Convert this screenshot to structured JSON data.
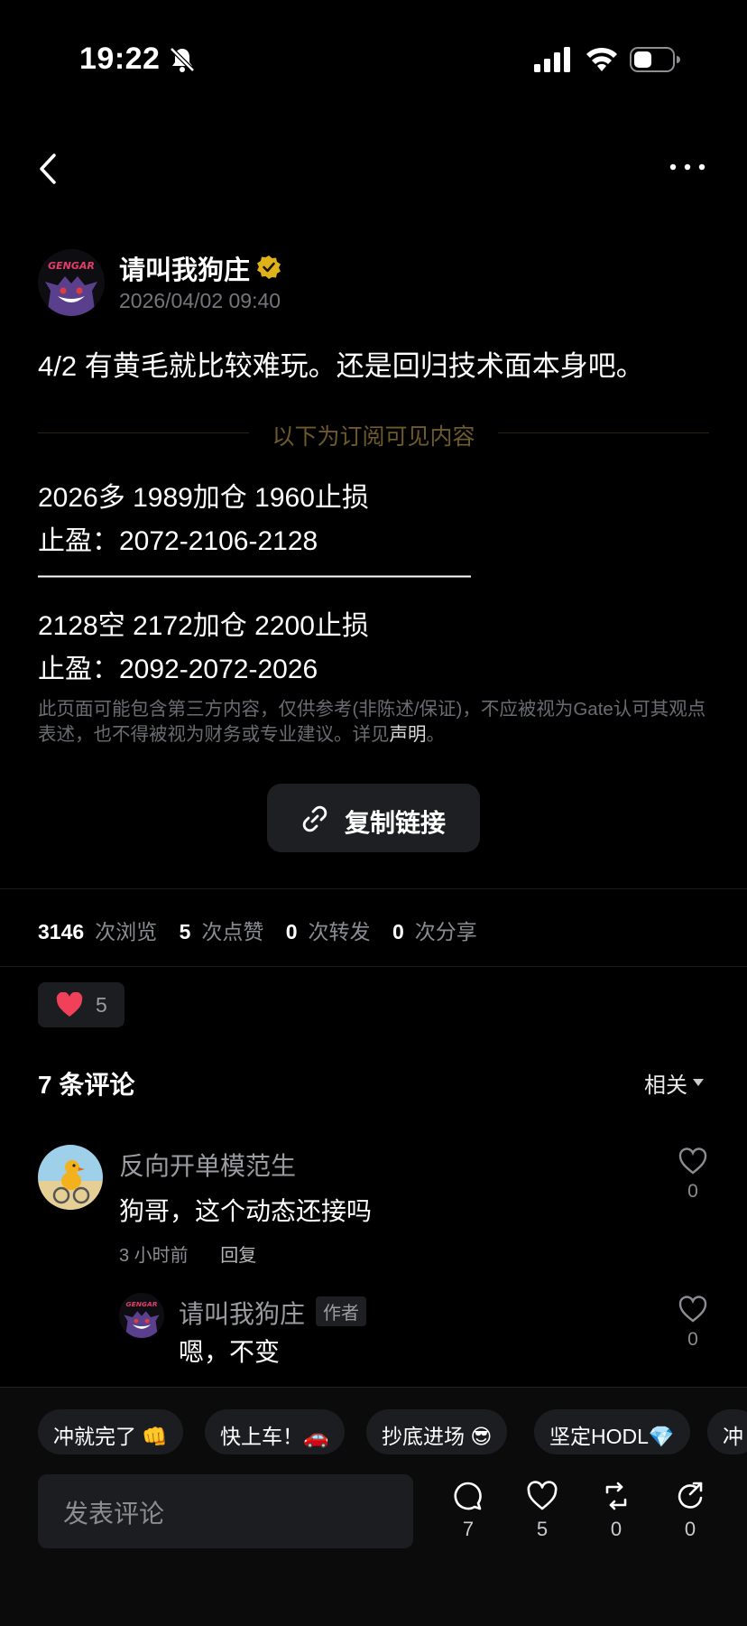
{
  "status_bar": {
    "time": "19:22"
  },
  "author": {
    "name": "请叫我狗庄",
    "date": "2026/04/02 09:40"
  },
  "post": {
    "body": "4/2 有黄毛就比较难玩。还是回归技术面本身吧。",
    "subscribe_label": "以下为订阅可见内容",
    "lines": [
      "2026多 1989加仓 1960止损",
      "止盈：2072-2106-2128",
      "————————————————",
      "2128空 2172加仓 2200止损",
      "止盈：2092-2072-2026"
    ],
    "disclaimer": "此页面可能包含第三方内容，仅供参考(非陈述/保证)，不应被视为Gate认可其观点表述，也不得被视为财务或专业建议。详见",
    "disclaimer_link": "声明",
    "disclaimer_end": "。",
    "copy_link_label": "复制链接"
  },
  "stats": {
    "views": "3146",
    "views_label": "次浏览",
    "likes": "5",
    "likes_label": "次点赞",
    "reposts": "0",
    "reposts_label": "次转发",
    "shares": "0",
    "shares_label": "次分享"
  },
  "reaction": {
    "heart_count": "5"
  },
  "comments": {
    "title": "7 条评论",
    "sort": "相关",
    "items": [
      {
        "name": "反向开单模范生",
        "text": "狗哥，这个动态还接吗",
        "time": "3 小时前",
        "reply": "回复",
        "likes": "0"
      }
    ],
    "reply": {
      "name": "请叫我狗庄",
      "tag": "作者",
      "text": "嗯，不变",
      "likes": "0"
    }
  },
  "bottom": {
    "chips": [
      "冲就完了 👊",
      "快上车！🚗",
      "抄底进场 😎",
      "坚定HODL💎",
      "冲"
    ],
    "input_placeholder": "发表评论",
    "actions": {
      "comments": "7",
      "likes": "5",
      "reposts": "0",
      "shares": "0"
    }
  },
  "colors": {
    "background": "#000000",
    "accent_gold": "#e0b21a",
    "heart_red": "#f0405a",
    "muted": "#8b8d93"
  }
}
